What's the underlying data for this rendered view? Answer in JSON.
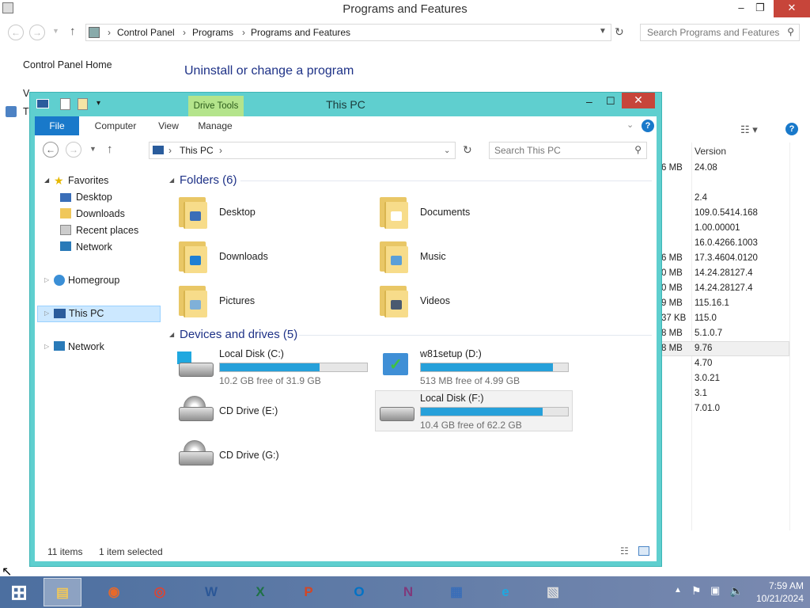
{
  "control_panel": {
    "title": "Programs and Features",
    "breadcrumb": [
      "Control Panel",
      "Programs",
      "Programs and Features"
    ],
    "search_placeholder": "Search Programs and Features",
    "left_link_home": "Control Panel Home",
    "left_link_2": "View installed updates",
    "left_link_3": "Turn Windows features on or off",
    "heading": "Uninstall or change a program",
    "version_header": "Version",
    "size_values": [
      "6 MB",
      "",
      "",
      "",
      "",
      "6 MB",
      "0 MB",
      "0 MB",
      "9 MB",
      "37 KB",
      "8 MB",
      "8 MB"
    ],
    "versions": [
      "24.08",
      "2.4",
      "109.0.5414.168",
      "1.00.00001",
      "16.0.4266.1003",
      "17.3.4604.0120",
      "14.24.28127.4",
      "14.24.28127.4",
      "115.16.1",
      "115.0",
      "5.1.0.7",
      "9.76",
      "4.70",
      "3.0.21",
      "3.1",
      "7.01.0"
    ]
  },
  "explorer": {
    "title": "This PC",
    "context_tab": "Drive Tools",
    "ribbon_tabs": [
      "File",
      "Computer",
      "View",
      "Manage"
    ],
    "address": "This PC",
    "search_placeholder": "Search This PC",
    "tree": {
      "favorites": "Favorites",
      "desktop": "Desktop",
      "downloads": "Downloads",
      "recent": "Recent places",
      "network_fav": "Network",
      "homegroup": "Homegroup",
      "thispc": "This PC",
      "network": "Network"
    },
    "folders_header": "Folders (6)",
    "folders": [
      "Desktop",
      "Documents",
      "Downloads",
      "Music",
      "Pictures",
      "Videos"
    ],
    "devices_header": "Devices and drives (5)",
    "drives": [
      {
        "name": "Local Disk (C:)",
        "free": "10.2 GB free of 31.9 GB",
        "used_fraction": 0.68
      },
      {
        "name": "w81setup (D:)",
        "free": "513 MB free of 4.99 GB",
        "used_fraction": 0.9
      },
      {
        "name": "Local Disk (F:)",
        "free": "10.4 GB free of 62.2 GB",
        "used_fraction": 0.83
      },
      {
        "name": "CD Drive (E:)"
      },
      {
        "name": "CD Drive (G:)"
      }
    ],
    "status_items": "11 items",
    "status_selected": "1 item selected"
  },
  "taskbar": {
    "time": "7:59 AM",
    "date": "10/21/2024",
    "apps": [
      "start-icon",
      "file-explorer-icon",
      "firefox-icon",
      "chrome-icon",
      "word-icon",
      "excel-icon",
      "powerpoint-icon",
      "outlook-icon",
      "onenote-icon",
      "remote-desktop-icon",
      "internet-explorer-icon",
      "control-panel-icon"
    ]
  },
  "colors": {
    "accent": "#1979ca",
    "explorer_frame": "#5fcfcf",
    "bar_fill": "#26a0da",
    "close": "#c7453a"
  }
}
